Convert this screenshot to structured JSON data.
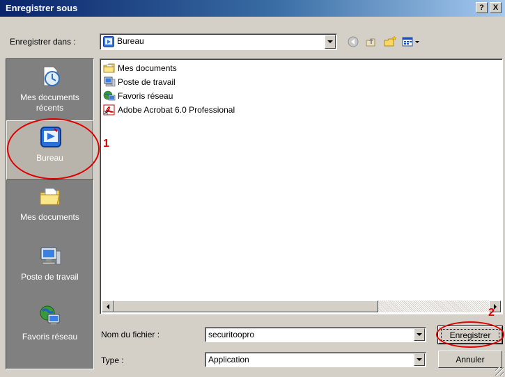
{
  "window": {
    "title": "Enregistrer sous",
    "help_label": "?",
    "close_label": "X"
  },
  "location": {
    "label": "Enregistrer dans :",
    "value": "Bureau",
    "toolbar_icons": [
      "back-icon",
      "up-folder-icon",
      "new-folder-icon",
      "view-menu-icon"
    ]
  },
  "places": [
    {
      "label": "Mes documents récents",
      "icon": "recent-documents-icon"
    },
    {
      "label": "Bureau",
      "icon": "desktop-icon",
      "selected": true
    },
    {
      "label": "Mes documents",
      "icon": "my-documents-icon"
    },
    {
      "label": "Poste de travail",
      "icon": "my-computer-icon"
    },
    {
      "label": "Favoris réseau",
      "icon": "network-places-icon"
    }
  ],
  "files": [
    {
      "name": "Mes documents",
      "icon": "folder-icon"
    },
    {
      "name": "Poste de travail",
      "icon": "computer-icon"
    },
    {
      "name": "Favoris réseau",
      "icon": "network-icon"
    },
    {
      "name": "Adobe Acrobat 6.0 Professional",
      "icon": "acrobat-shortcut-icon"
    }
  ],
  "filename": {
    "label": "Nom du fichier :",
    "value": "securitoopro"
  },
  "filetype": {
    "label": "Type :",
    "value": "Application"
  },
  "buttons": {
    "save": "Enregistrer",
    "cancel": "Annuler"
  },
  "annotations": {
    "step1": "1",
    "step2": "2",
    "color": "#e00000"
  },
  "colors": {
    "title_bar": "#0a246a",
    "dialog_bg": "#d4d0c8",
    "places_bg": "#808080"
  }
}
